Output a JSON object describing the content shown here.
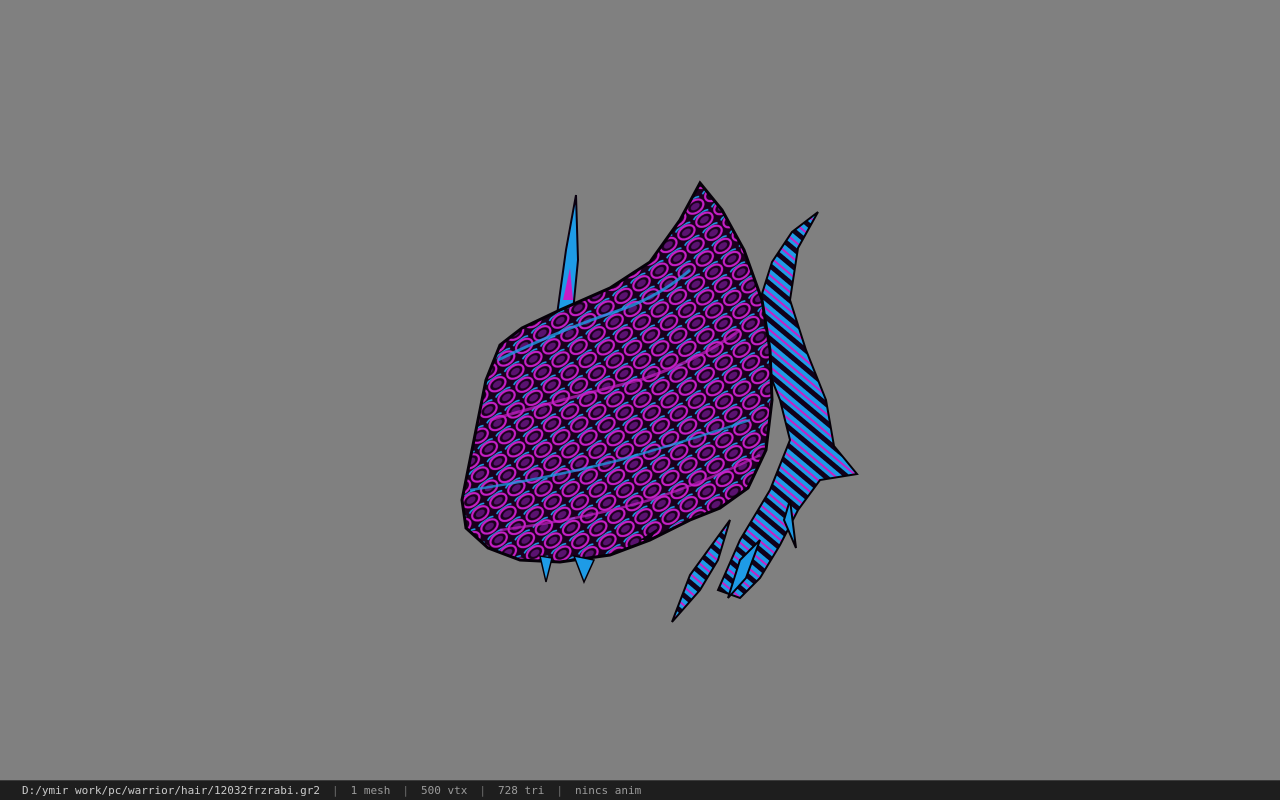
{
  "viewport": {
    "background_color": "#808080",
    "model": {
      "colors": {
        "dark": "#140014",
        "blue": "#1e9be6",
        "magenta": "#c61fc6",
        "purple": "#4a0e5a"
      }
    }
  },
  "statusbar": {
    "file_path": "D:/ymir work/pc/warrior/hair/12032frzrabi.gr2",
    "mesh": "1 mesh",
    "vertices": "500 vtx",
    "triangles": "728 tri",
    "anim": "nincs anim",
    "separator": "|"
  }
}
